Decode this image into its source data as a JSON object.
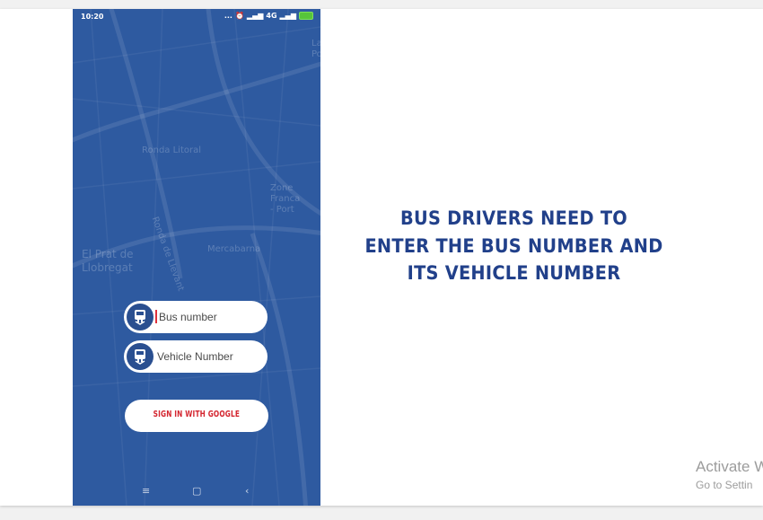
{
  "headline_lines": [
    "BUS DRIVERS NEED TO",
    "ENTER THE BUS NUMBER AND",
    "ITS VEHICLE NUMBER"
  ],
  "phone": {
    "status_bar": {
      "time": "10:20",
      "dots": "...",
      "network": "4G",
      "battery_color": "#57c43a"
    },
    "map_labels": [
      "Ronda Litoral",
      "Zone Franca\n- Port",
      "Ronda de Llevant",
      "El Prat de\nLlobregat",
      "Mercabarna",
      "La\nPo"
    ],
    "bus_number_field": {
      "placeholder": "Bus number",
      "icon": "bus-icon"
    },
    "vehicle_number_field": {
      "placeholder": "Vehicle Number",
      "icon": "bus-icon"
    },
    "google_button_label": "SIGN IN WITH GOOGLE",
    "nav_bar": {
      "menu": "≡",
      "home": "▢",
      "back": "‹"
    },
    "background_color": "#2e5aa0"
  },
  "watermark": {
    "line1": "Activate W",
    "line2": "Go to Settin"
  },
  "colors": {
    "headline": "#21408a",
    "accent_red": "#d4252f"
  }
}
